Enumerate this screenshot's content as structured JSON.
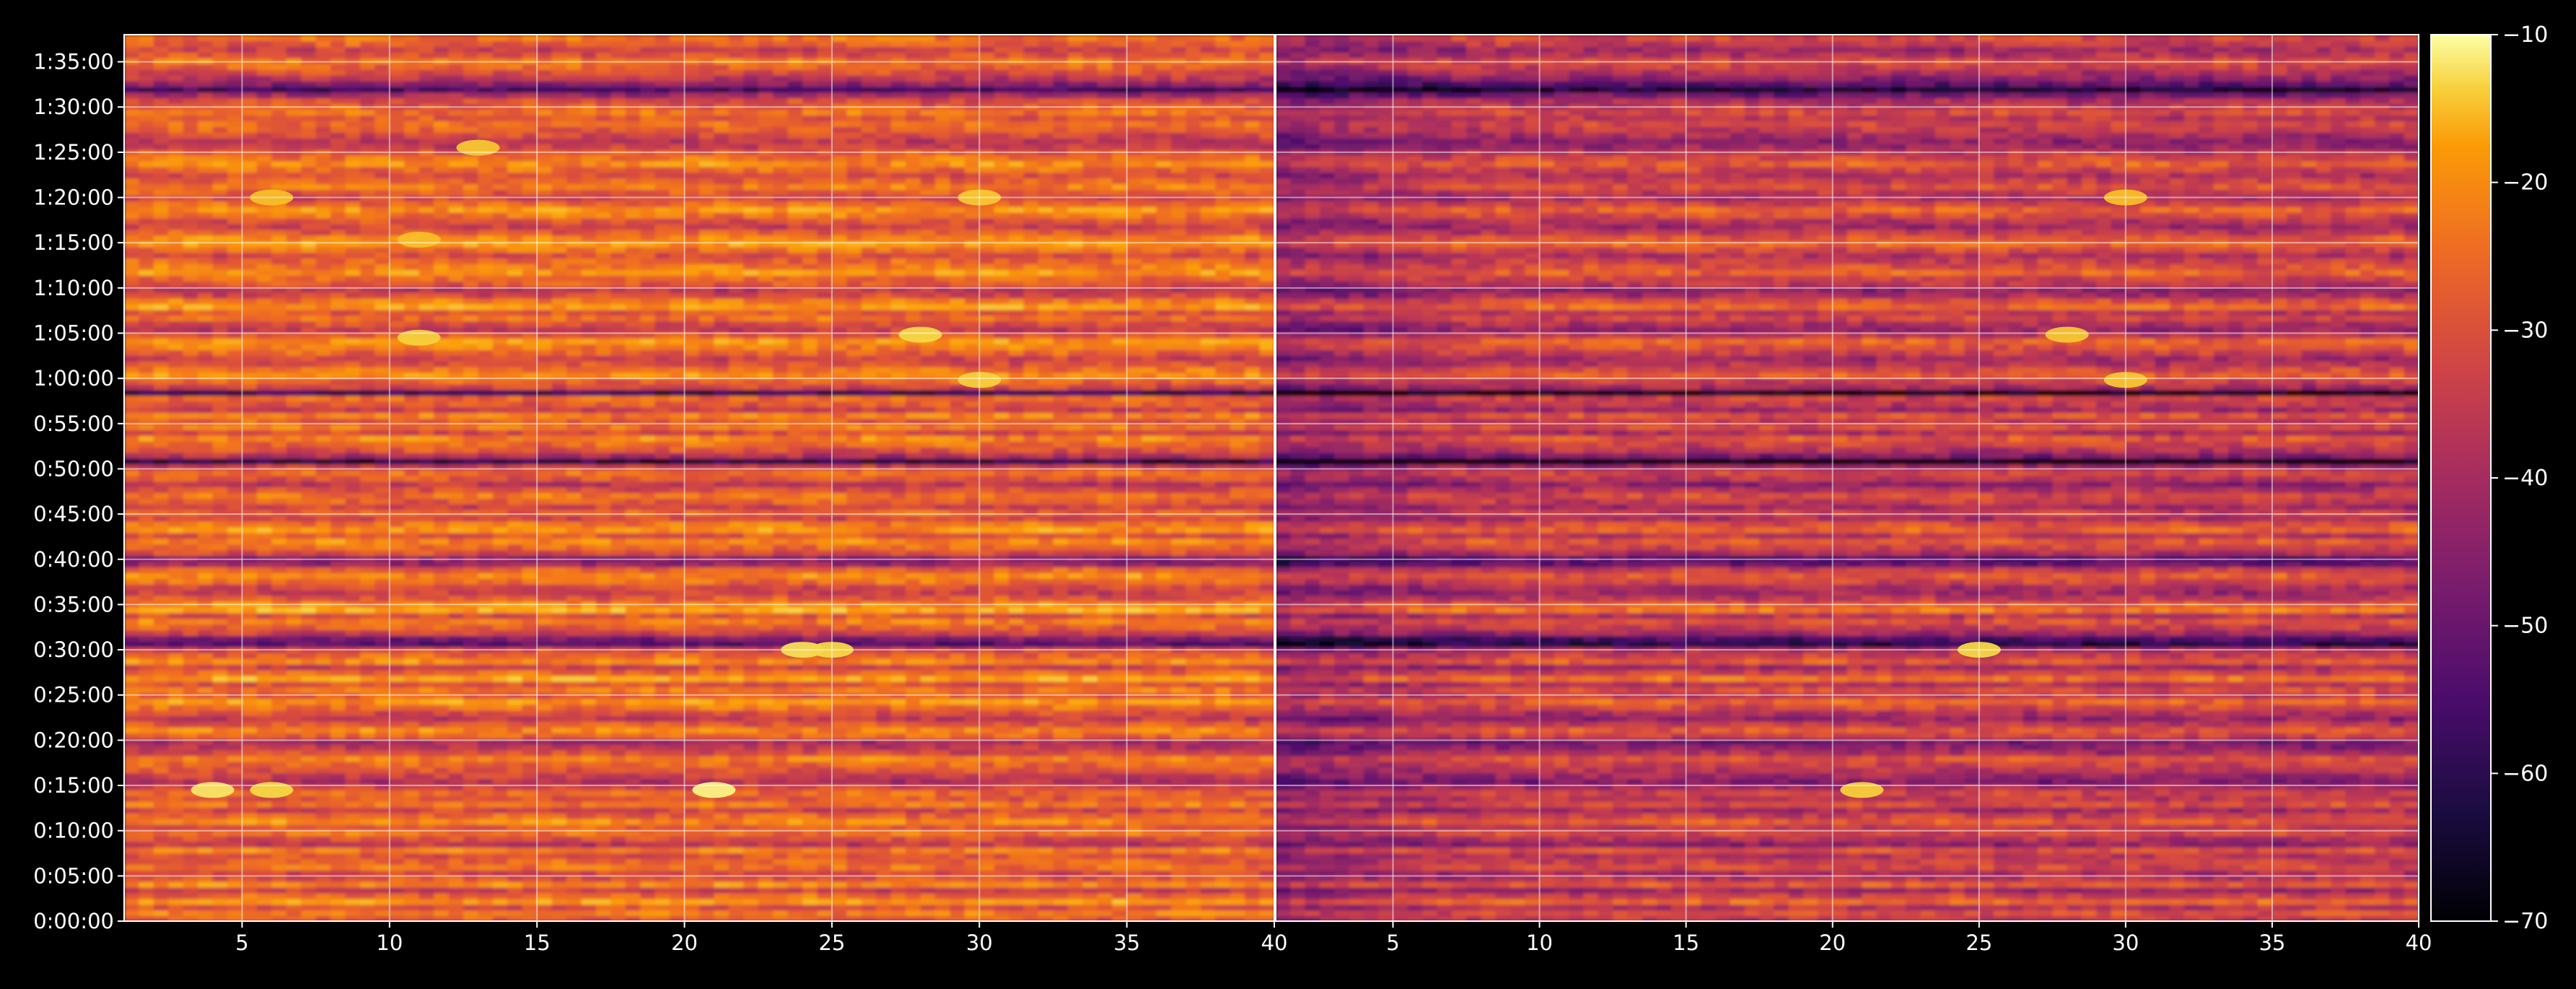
{
  "chart_data": {
    "type": "heatmap",
    "colormap": "inferno",
    "background": "#000000",
    "panels": [
      {
        "name": "",
        "x_ticks": [
          5,
          10,
          15,
          20,
          25,
          30,
          35,
          40
        ],
        "x_range": [
          1,
          40
        ]
      },
      {
        "name": "",
        "x_ticks": [
          5,
          10,
          15,
          20,
          25,
          30,
          35,
          40
        ],
        "x_range": [
          1,
          40
        ]
      }
    ],
    "y_ticks": [
      "0:00:00",
      "0:05:00",
      "0:10:00",
      "0:15:00",
      "0:20:00",
      "0:25:00",
      "0:30:00",
      "0:35:00",
      "0:40:00",
      "0:45:00",
      "0:50:00",
      "0:55:00",
      "1:00:00",
      "1:05:00",
      "1:10:00",
      "1:15:00",
      "1:20:00",
      "1:25:00",
      "1:30:00",
      "1:35:00"
    ],
    "y_range_seconds": [
      0,
      5880
    ],
    "colorbar": {
      "ticks": [
        -10,
        -20,
        -30,
        -40,
        -50,
        -60,
        -70
      ],
      "tick_labels": [
        "−10",
        "−20",
        "−30",
        "−40",
        "−50",
        "−60",
        "−70"
      ],
      "range": [
        -70,
        -10
      ]
    },
    "row_levels": [
      -32,
      -28,
      -34,
      -24,
      -30,
      -38,
      -26,
      -33,
      -36,
      -29,
      -31,
      -34,
      -27,
      -40,
      -35,
      -29,
      -32,
      -25,
      -31,
      -37,
      -28,
      -33,
      -30,
      -36,
      -42,
      -38,
      -34,
      -31,
      -27,
      -36,
      -40,
      -44,
      -30,
      -26,
      -33,
      -39,
      -35,
      -29,
      -24,
      -32,
      -28,
      -34,
      -22,
      -30,
      -37,
      -26,
      -31,
      -35,
      -55,
      -50,
      -38,
      -32,
      -27,
      -34,
      -21,
      -26,
      -33,
      -38,
      -36,
      -29,
      -25,
      -31,
      -45,
      -48,
      -35,
      -30,
      -26,
      -33,
      -24,
      -28,
      -36,
      -31,
      -37,
      -32,
      -29,
      -35,
      -40,
      -33,
      -30,
      -38,
      -62,
      -42,
      -34,
      -30,
      -26,
      -35,
      -28,
      -32,
      -27,
      -38,
      -33,
      -30,
      -60,
      -36,
      -31,
      -25,
      -29,
      -34,
      -37,
      -31,
      -27,
      -24,
      -33,
      -39,
      -35,
      -29,
      -33,
      -23,
      -28,
      -36,
      -40,
      -33,
      -30,
      -24,
      -28,
      -31,
      -35,
      -29,
      -23,
      -26,
      -32,
      -37,
      -34,
      -28,
      -24,
      -30,
      -36,
      -33,
      -27,
      -31,
      -35,
      -30,
      -25,
      -29,
      -33,
      -38,
      -40,
      -36,
      -32,
      -30,
      -33,
      -29,
      -32,
      -35,
      -44,
      -58,
      -47,
      -40,
      -35,
      -31,
      -28,
      -34,
      -37,
      -32,
      -29
    ],
    "panel2_offset": -7,
    "hot_spots": [
      {
        "panel": 0,
        "x": 4,
        "t": 870,
        "v": -14
      },
      {
        "panel": 0,
        "x": 21,
        "t": 870,
        "v": -12
      },
      {
        "panel": 0,
        "x": 6,
        "t": 870,
        "v": -16
      },
      {
        "panel": 0,
        "x": 24,
        "t": 1800,
        "v": -15
      },
      {
        "panel": 0,
        "x": 25,
        "t": 1800,
        "v": -16
      },
      {
        "panel": 0,
        "x": 28,
        "t": 3890,
        "v": -16
      },
      {
        "panel": 0,
        "x": 30,
        "t": 3590,
        "v": -17
      },
      {
        "panel": 0,
        "x": 11,
        "t": 3870,
        "v": -17
      },
      {
        "panel": 0,
        "x": 13,
        "t": 5130,
        "v": -18
      },
      {
        "panel": 0,
        "x": 6,
        "t": 4800,
        "v": -19
      },
      {
        "panel": 0,
        "x": 11,
        "t": 4520,
        "v": -19
      },
      {
        "panel": 0,
        "x": 30,
        "t": 4800,
        "v": -18
      },
      {
        "panel": 1,
        "x": 21,
        "t": 870,
        "v": -17
      },
      {
        "panel": 1,
        "x": 25,
        "t": 1800,
        "v": -16
      },
      {
        "panel": 1,
        "x": 28,
        "t": 3890,
        "v": -18
      },
      {
        "panel": 1,
        "x": 30,
        "t": 3590,
        "v": -18
      },
      {
        "panel": 1,
        "x": 30,
        "t": 4800,
        "v": -19
      }
    ]
  }
}
